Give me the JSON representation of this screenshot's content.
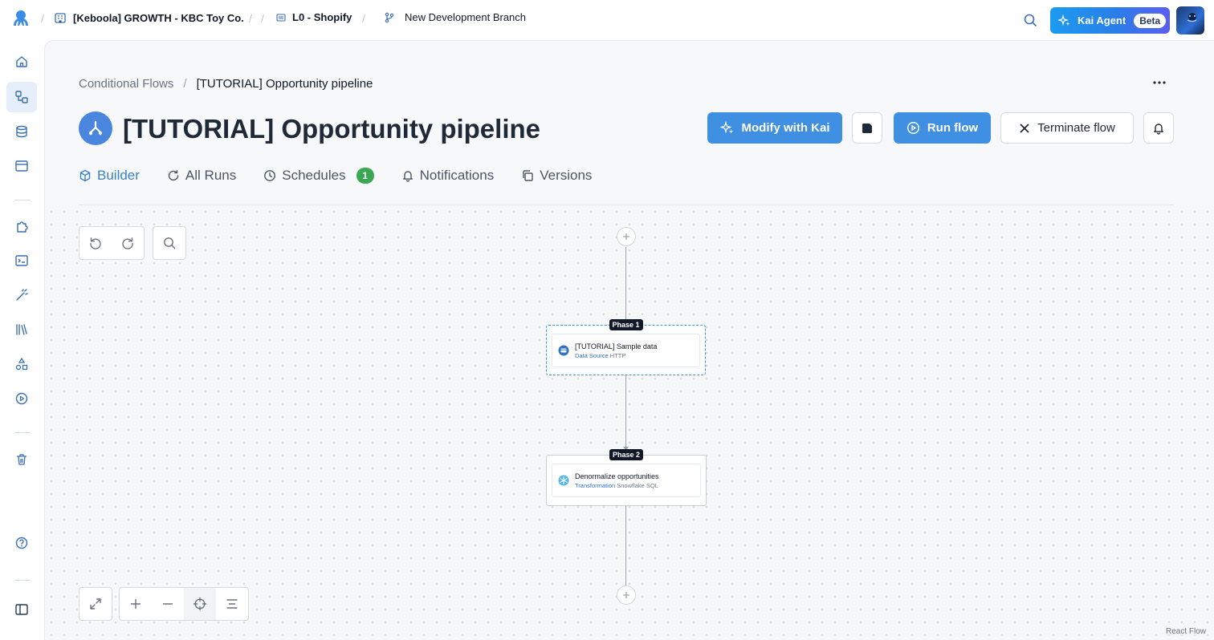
{
  "topbar": {
    "project": "[Keboola] GROWTH - KBC Toy Co.",
    "folder": "L0 - Shopify",
    "branch": "New Development Branch",
    "kai_agent_label": "Kai Agent",
    "kai_agent_badge": "Beta"
  },
  "sidebar": {
    "items": [
      "home-icon",
      "flows-icon",
      "storage-icon",
      "components-icon",
      "integrations-icon",
      "terminal-icon",
      "magic-wand-icon",
      "library-icon",
      "shapes-icon",
      "jobs-icon",
      "trash-icon",
      "help-icon",
      "sidebar-toggle-icon"
    ],
    "active": "flows-icon"
  },
  "breadcrumb": {
    "parent": "Conditional Flows",
    "current": "[TUTORIAL] Opportunity pipeline"
  },
  "page": {
    "title": "[TUTORIAL] Opportunity pipeline"
  },
  "actions": {
    "modify_with_kai": "Modify with Kai",
    "run_flow": "Run flow",
    "terminate_flow": "Terminate flow"
  },
  "tabs": [
    {
      "label": "Builder",
      "active": true
    },
    {
      "label": "All Runs"
    },
    {
      "label": "Schedules",
      "badge": "1"
    },
    {
      "label": "Notifications"
    },
    {
      "label": "Versions"
    }
  ],
  "flow": {
    "phases": [
      {
        "label": "Phase 1",
        "tasks": [
          {
            "name": "[TUTORIAL] Sample data",
            "type": "Data Source",
            "component": "HTTP"
          }
        ]
      },
      {
        "label": "Phase 2",
        "tasks": [
          {
            "name": "Denormalize opportunities",
            "type": "Transformation",
            "component": "Snowflake SQL"
          }
        ]
      }
    ]
  },
  "footer": {
    "attribution": "React Flow"
  },
  "colors": {
    "accent": "#3f8fe3",
    "badge_green": "#3aa852"
  }
}
